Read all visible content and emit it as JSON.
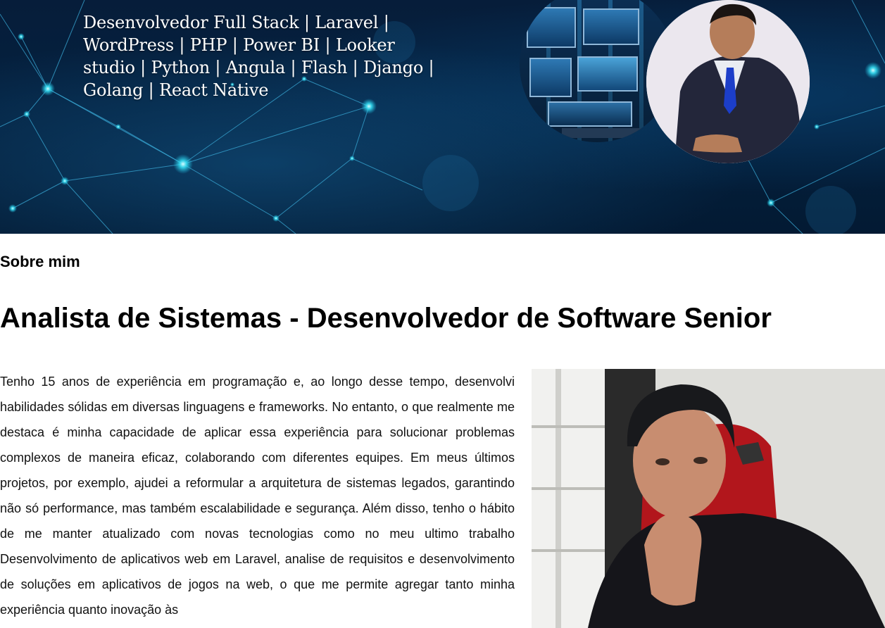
{
  "hero": {
    "title": "Desenvolvedor Full Stack | Laravel | WordPress | PHP | Power BI | Looker studio | Python | Angula | Flash | Django | Golang | React Native",
    "background_color": "#04213f",
    "accent_color": "#2fd6f0"
  },
  "about": {
    "section_label": "Sobre mim",
    "title": "Analista de Sistemas - Desenvolvedor de Software Senior",
    "bio": "Tenho 15 anos de experiência em programação e, ao longo desse tempo, desenvolvi habilidades sólidas em diversas linguagens e frameworks. No entanto, o que realmente me destaca é minha capacidade de aplicar essa experiência para solucionar problemas complexos de maneira eficaz, colaborando com diferentes equipes. Em meus últimos projetos, por exemplo, ajudei a reformular a arquitetura de sistemas legados, garantindo não só performance, mas também escalabilidade e segurança. Além disso, tenho o hábito de me manter atualizado com novas tecnologias como no meu ultimo trabalho Desenvolvimento de aplicativos web em Laravel, analise de requisitos e desenvolvimento de soluções em aplicativos de jogos na web, o que me permite agregar tanto minha experiência quanto inovação às"
  },
  "icons": {
    "hero_background": "network-background-image",
    "monitor": "monitors-circle-image",
    "portrait": "profile-portrait-image",
    "photo": "profile-photo-image"
  }
}
